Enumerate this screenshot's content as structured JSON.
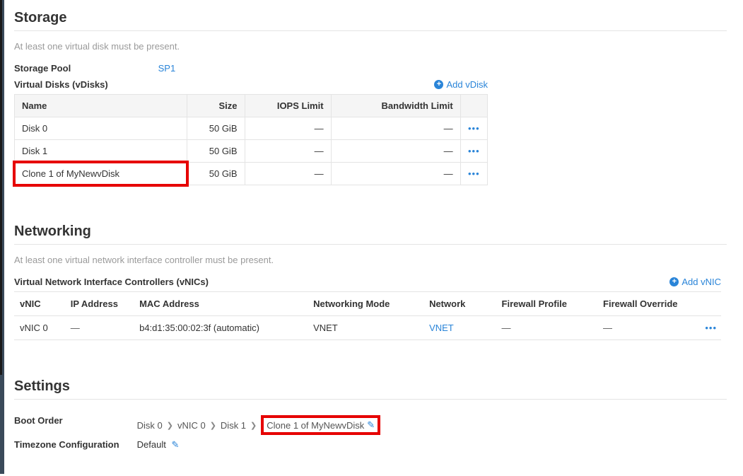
{
  "storage": {
    "title": "Storage",
    "helper": "At least one virtual disk must be present.",
    "pool_label": "Storage Pool",
    "pool_value": "SP1",
    "vdisks_label": "Virtual Disks (vDisks)",
    "add_label": "Add vDisk",
    "cols": {
      "name": "Name",
      "size": "Size",
      "iops": "IOPS Limit",
      "bw": "Bandwidth Limit"
    },
    "rows": [
      {
        "name": "Disk 0",
        "size": "50 GiB",
        "iops": "—",
        "bw": "—"
      },
      {
        "name": "Disk 1",
        "size": "50 GiB",
        "iops": "—",
        "bw": "—"
      },
      {
        "name": "Clone 1 of MyNewvDisk",
        "size": "50 GiB",
        "iops": "—",
        "bw": "—"
      }
    ]
  },
  "networking": {
    "title": "Networking",
    "helper": "At least one virtual network interface controller must be present.",
    "vnics_label": "Virtual Network Interface Controllers (vNICs)",
    "add_label": "Add vNIC",
    "cols": {
      "vnic": "vNIC",
      "ip": "IP Address",
      "mac": "MAC Address",
      "mode": "Networking Mode",
      "net": "Network",
      "fw": "Firewall Profile",
      "ov": "Firewall Override"
    },
    "rows": [
      {
        "vnic": "vNIC 0",
        "ip": "—",
        "mac": "b4:d1:35:00:02:3f (automatic)",
        "mode": "VNET",
        "net": "VNET",
        "fw": "—",
        "ov": "—"
      }
    ]
  },
  "settings": {
    "title": "Settings",
    "boot_label": "Boot Order",
    "boot_items": [
      "Disk 0",
      "vNIC 0",
      "Disk 1",
      "Clone 1 of MyNewvDisk"
    ],
    "tz_label": "Timezone Configuration",
    "tz_value": "Default"
  },
  "glyphs": {
    "dots": "•••",
    "pencil": "✎",
    "chev": "❯"
  }
}
